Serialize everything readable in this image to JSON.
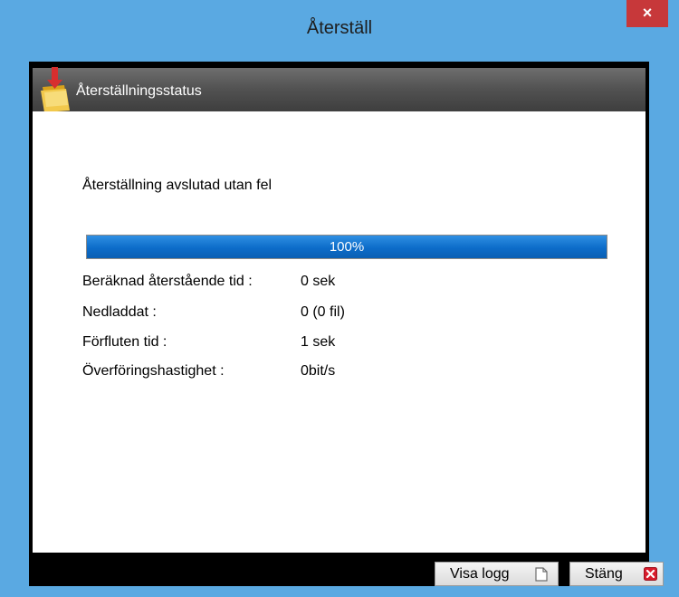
{
  "window": {
    "title": "Återställ",
    "close_glyph": "×"
  },
  "section": {
    "title": "Återställningsstatus",
    "icon": "restore-folder-icon"
  },
  "status": {
    "message": "Återställning avslutad utan fel"
  },
  "progress": {
    "percent": 100,
    "label": "100%"
  },
  "info": {
    "rows": [
      {
        "label": "Beräknad återstående tid :",
        "value": "0 sek"
      },
      {
        "label": "Nedladdat :",
        "value": "0 (0 fil)"
      },
      {
        "label": "Förfluten tid :",
        "value": "1 sek"
      },
      {
        "label": "Överföringshastighet :",
        "value": "0bit/s"
      }
    ]
  },
  "buttons": {
    "view_log": {
      "label": "Visa logg",
      "icon": "document-icon"
    },
    "close": {
      "label": "Stäng",
      "icon": "close-red-icon"
    }
  },
  "colors": {
    "titlebar": "#5aa9e2",
    "close_button": "#c7383a",
    "progress_fill": "#0c6cc9"
  }
}
